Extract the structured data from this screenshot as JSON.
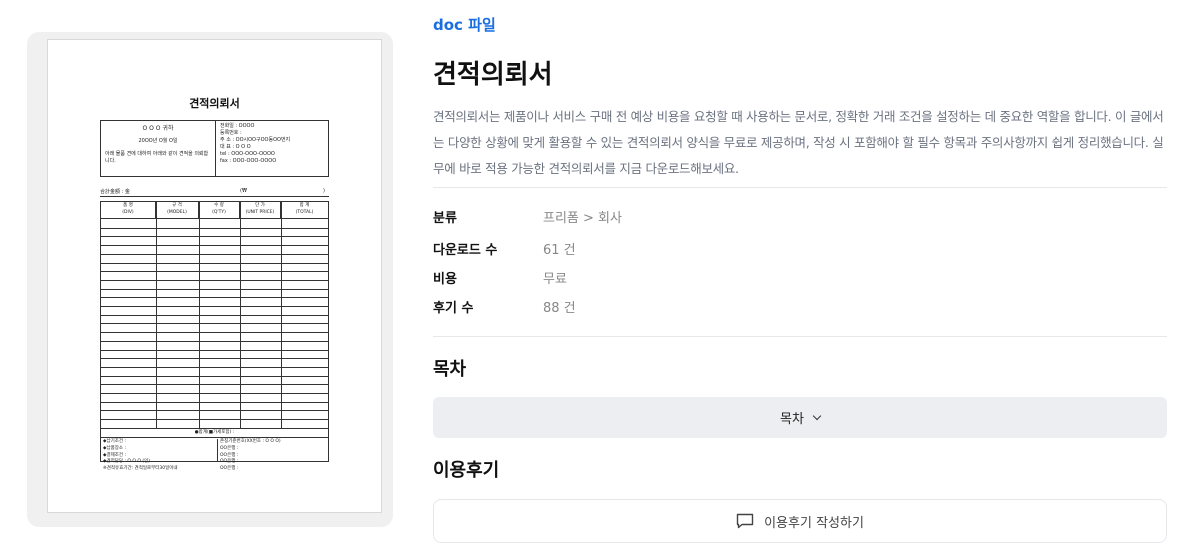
{
  "file_type": "doc 파일",
  "title": "견적의뢰서",
  "description": "견적의뢰서는 제품이나 서비스 구매 전 예상 비용을 요청할 때 사용하는 문서로, 정확한 거래 조건을 설정하는 데 중요한 역할을 합니다. 이 글에서는 다양한 상황에 맞게 활용할 수 있는 견적의뢰서 양식을 무료로 제공하며, 작성 시 포함해야 할 필수 항목과 주의사항까지 쉽게 정리했습니다. 실무에 바로 적용 가능한 견적의뢰서를 지금 다운로드해보세요.",
  "info": {
    "category_label": "분류",
    "category_value": "프리폼 > 회사",
    "downloads_label": "다운로드 수",
    "downloads_value": "61 건",
    "cost_label": "비용",
    "cost_value": "무료",
    "reviews_label": "후기 수",
    "reviews_value": "88 건"
  },
  "toc": {
    "section_title": "목차",
    "button_label": "목차"
  },
  "reviews": {
    "section_title": "이용후기",
    "button_label": "이용후기 작성하기"
  },
  "preview": {
    "doc_title": "견적의뢰서",
    "head_left": [
      "O O O 귀하",
      "20OO년 O월 O일",
      "아래 물품 견에 대하여 아래와 같이 견적을 의뢰합니다."
    ],
    "head_right": [
      "전화일 : OOOO",
      "등록번호 :",
      "주 소 : OO시OO구OO동OO번지",
      "대 표 : O O O",
      "tel : OOO-OOO-OOOO",
      "fax : OOO-OOO-OOOO"
    ],
    "sum_label": "合計金額 : 金",
    "sum_won": "(₩",
    "sum_paren": ")",
    "columns": [
      {
        "ko": "품 명",
        "en": "(DIV)"
      },
      {
        "ko": "규 격",
        "en": "(MODEL)"
      },
      {
        "ko": "수 량",
        "en": "(Q'TY)"
      },
      {
        "ko": "단 가",
        "en": "(UNIT PRICE)"
      },
      {
        "ko": "합 계",
        "en": "(TOTAL)"
      }
    ],
    "total_label": "●합계(■가세포함) :",
    "foot_left": [
      "◆납기조건 :",
      "◆납품장소 :",
      "◆결제조건 :",
      "◆견적담당 : O O O (인)",
      "※견적유효기간: 견적일로부터30일이내"
    ],
    "foot_right": [
      "존칭기준번호(XX번호 : O O O)",
      "OO은행 :",
      "OO은행 :",
      "OO은행 :",
      "OO은행 :"
    ]
  }
}
